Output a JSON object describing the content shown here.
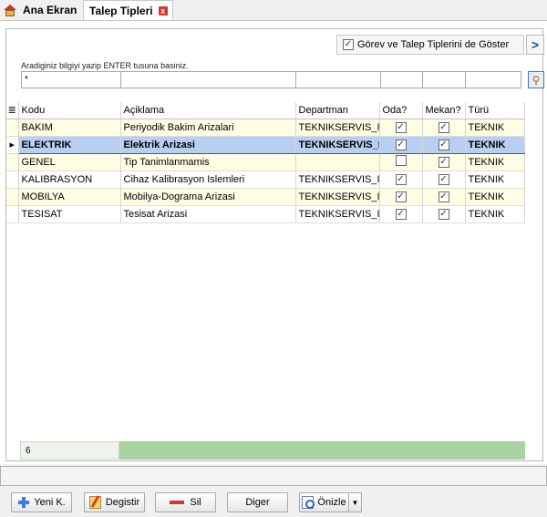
{
  "tabs": {
    "home_label": "Ana Ekran",
    "active_label": "Talep Tipleri",
    "close_glyph": "x"
  },
  "options": {
    "show_tasks_label": "Görev ve Talep Tiplerini de Göster",
    "show_tasks_checked": true,
    "next_glyph": ">"
  },
  "search": {
    "hint": "Aradiginiz bilgiyi yazip ENTER tusuna basiniz.",
    "value": "*"
  },
  "grid": {
    "columns": [
      "Kodu",
      "Açiklama",
      "Departman",
      "Oda?",
      "Mekan?",
      "Türü"
    ],
    "rows": [
      {
        "kodu": "BAKIM",
        "aciklama": "Periyodik Bakim Arizalari",
        "departman": "TEKNIKSERVIS_I",
        "oda": true,
        "mekan": true,
        "turu": "TEKNIK"
      },
      {
        "kodu": "ELEKTRIK",
        "aciklama": "Elektrik Arizasi",
        "departman": "TEKNIKSERVIS_D",
        "oda": true,
        "mekan": true,
        "turu": "TEKNIK"
      },
      {
        "kodu": "GENEL",
        "aciklama": "Tip Tanimlanmamis",
        "departman": "",
        "oda": false,
        "mekan": true,
        "turu": "TEKNIK"
      },
      {
        "kodu": "KALIBRASYON",
        "aciklama": "Cihaz Kalibrasyon Islemleri",
        "departman": "TEKNIKSERVIS_I",
        "oda": true,
        "mekan": true,
        "turu": "TEKNIK"
      },
      {
        "kodu": "MOBILYA",
        "aciklama": "Mobilya-Dograma Arizasi",
        "departman": "TEKNIKSERVIS_I",
        "oda": true,
        "mekan": true,
        "turu": "TEKNIK"
      },
      {
        "kodu": "TESISAT",
        "aciklama": "Tesisat Arizasi",
        "departman": "TEKNIKSERVIS_I",
        "oda": true,
        "mekan": true,
        "turu": "TEKNIK"
      }
    ],
    "selected_index": 1,
    "row_count": "6"
  },
  "toolbar": {
    "new_label": "Yeni K.",
    "edit_label": "Degistir",
    "delete_label": "Sil",
    "other_label": "Diger",
    "preview_label": "Önizle"
  }
}
